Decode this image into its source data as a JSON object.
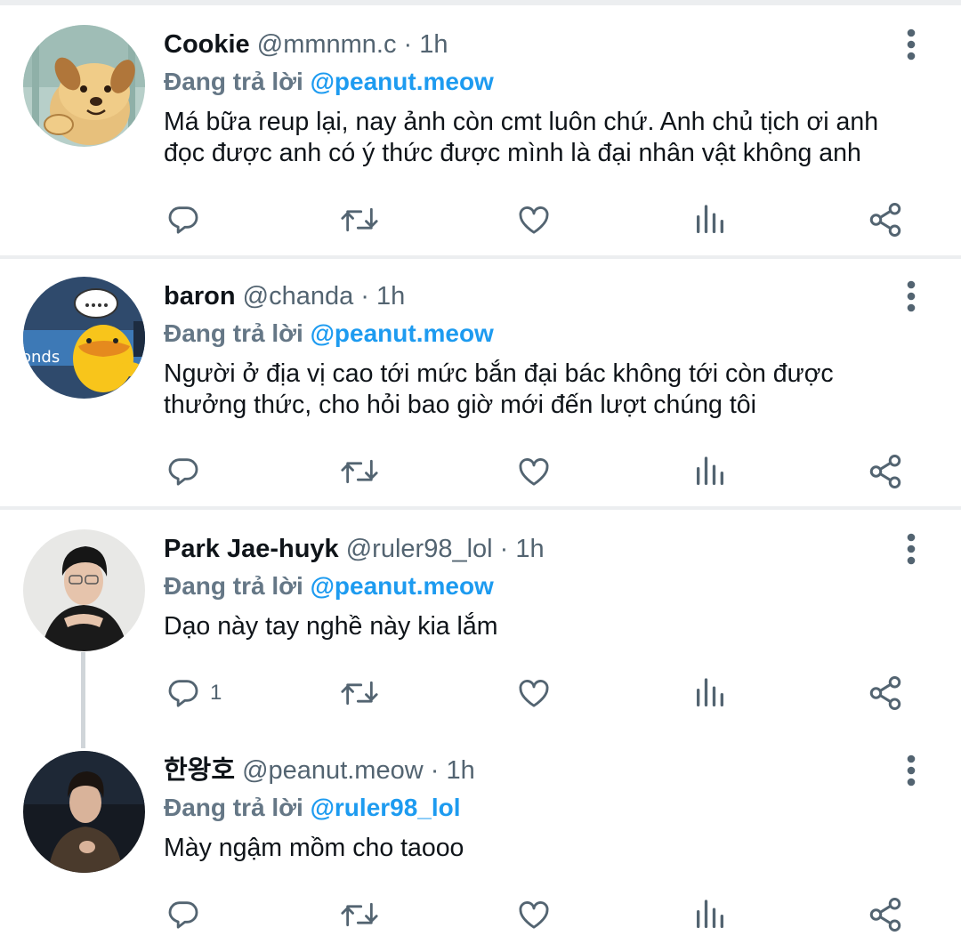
{
  "replying_label": "Đang trả lời",
  "colors": {
    "accent": "#1d9bf0",
    "icon": "#536471",
    "text": "#0f1419",
    "muted": "#536471"
  },
  "tweets": [
    {
      "name": "Cookie",
      "handle": "@mmnmn.c",
      "time": "· 1h",
      "replying_to": "@peanut.meow",
      "text_lines": [
        "Má bữa reup lại, nay ảnh còn cmt luôn chứ. Anh chủ tịch ơi anh",
        "đọc được anh có ý thức được mình là đại nhân vật không anh"
      ],
      "reply_count": "",
      "avatar": "cartoon-dog"
    },
    {
      "name": "baron",
      "handle": "@chanda",
      "time": "· 1h",
      "replying_to": "@peanut.meow",
      "text_lines": [
        "Người ở địa vị cao tới mức bắn đại bác không tới còn được",
        "thưởng thức, cho hỏi bao giờ mới đến lượt chúng tôi"
      ],
      "reply_count": "",
      "avatar": "cartoon-duck",
      "avatar_text": "onds"
    },
    {
      "name": "Park Jae-huyk",
      "handle": "@ruler98_lol",
      "time": "· 1h",
      "replying_to": "@peanut.meow",
      "text_lines": [
        "Dạo này tay nghề này kia lắm"
      ],
      "reply_count": "1",
      "avatar": "photo-person"
    },
    {
      "name": "한왕호",
      "handle": "@peanut.meow",
      "time": "· 1h",
      "replying_to": "@ruler98_lol",
      "text_lines": [
        "Mày ngậm mồm cho taooo"
      ],
      "reply_count": "",
      "avatar": "photo-person"
    }
  ],
  "icons": [
    "more-vertical-icon",
    "reply-icon",
    "retweet-icon",
    "like-icon",
    "analytics-icon",
    "share-icon"
  ]
}
